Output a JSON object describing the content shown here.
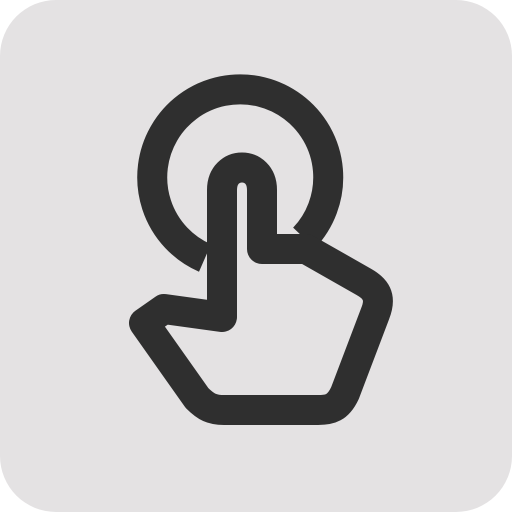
{
  "icon": {
    "name": "tap-gesture-icon",
    "stroke_color": "#2f2f2f",
    "background_color": "#e4e2e3"
  }
}
